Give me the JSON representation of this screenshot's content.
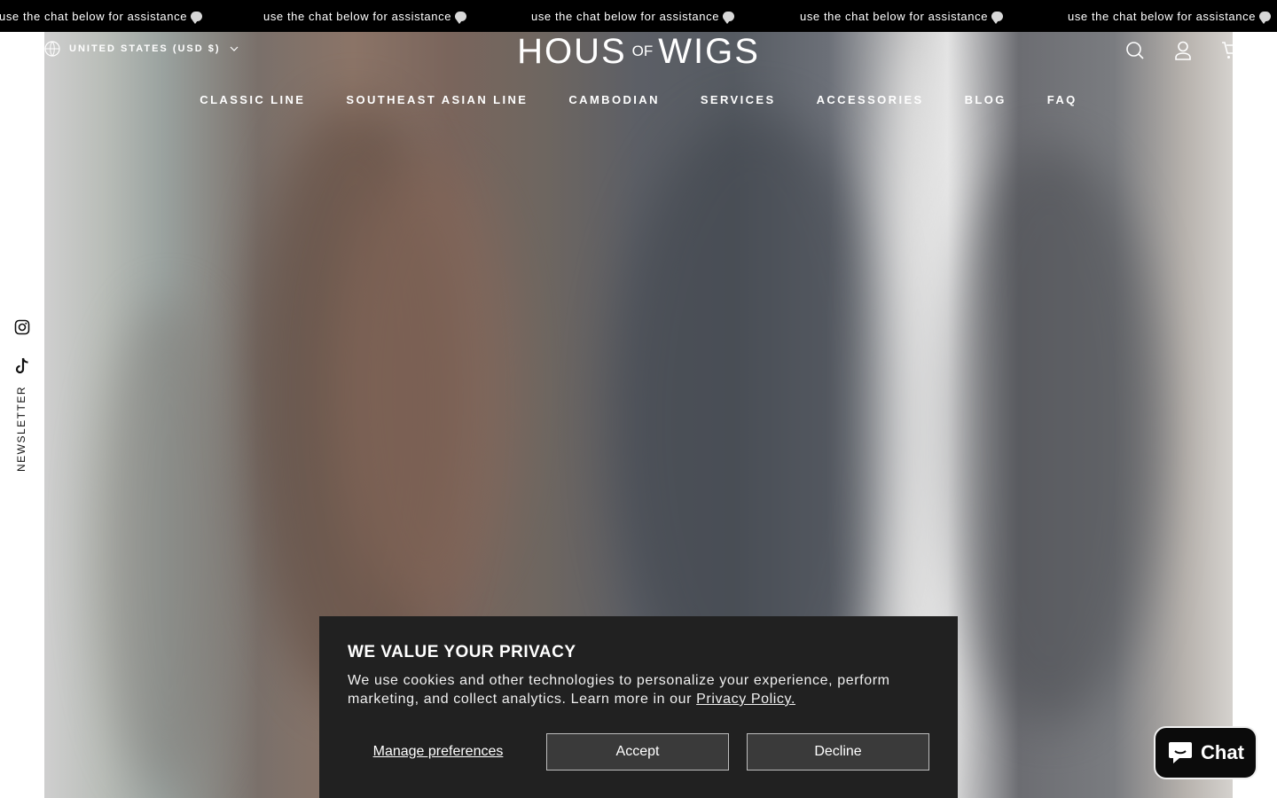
{
  "announcement": {
    "text": "use the chat below for assistance",
    "icon": "speech-bubble-icon",
    "repeats": [
      "use the chat below for assistance",
      "use the chat below for assistance",
      "use the chat below for assistance",
      "use the chat below for assistance",
      "use the chat below for assistance"
    ]
  },
  "header": {
    "locale_label": "UNITED STATES (USD $)",
    "logo": {
      "part1": "HOUS",
      "part2": "OF",
      "part3": "WIGS"
    },
    "icons": [
      "search-icon",
      "account-icon",
      "cart-icon"
    ]
  },
  "nav": {
    "items": [
      "CLASSIC LINE",
      "SOUTHEAST ASIAN LINE",
      "CAMBODIAN",
      "SERVICES",
      "ACCESSORIES",
      "BLOG",
      "FAQ"
    ]
  },
  "social": {
    "icons": [
      "instagram-icon",
      "tiktok-icon"
    ],
    "newsletter_label": "NEWSLETTER"
  },
  "cookie": {
    "title": "WE VALUE YOUR PRIVACY",
    "body": "We use cookies and other technologies to personalize your experience, perform marketing, and collect analytics. Learn more in our",
    "link": "Privacy Policy.",
    "manage": "Manage preferences",
    "accept": "Accept",
    "decline": "Decline"
  },
  "chat": {
    "label": "Chat"
  },
  "colors": {
    "announcement_bg": "#000000",
    "banner_bg": "#212121",
    "chat_bg": "#0b0b0b"
  }
}
